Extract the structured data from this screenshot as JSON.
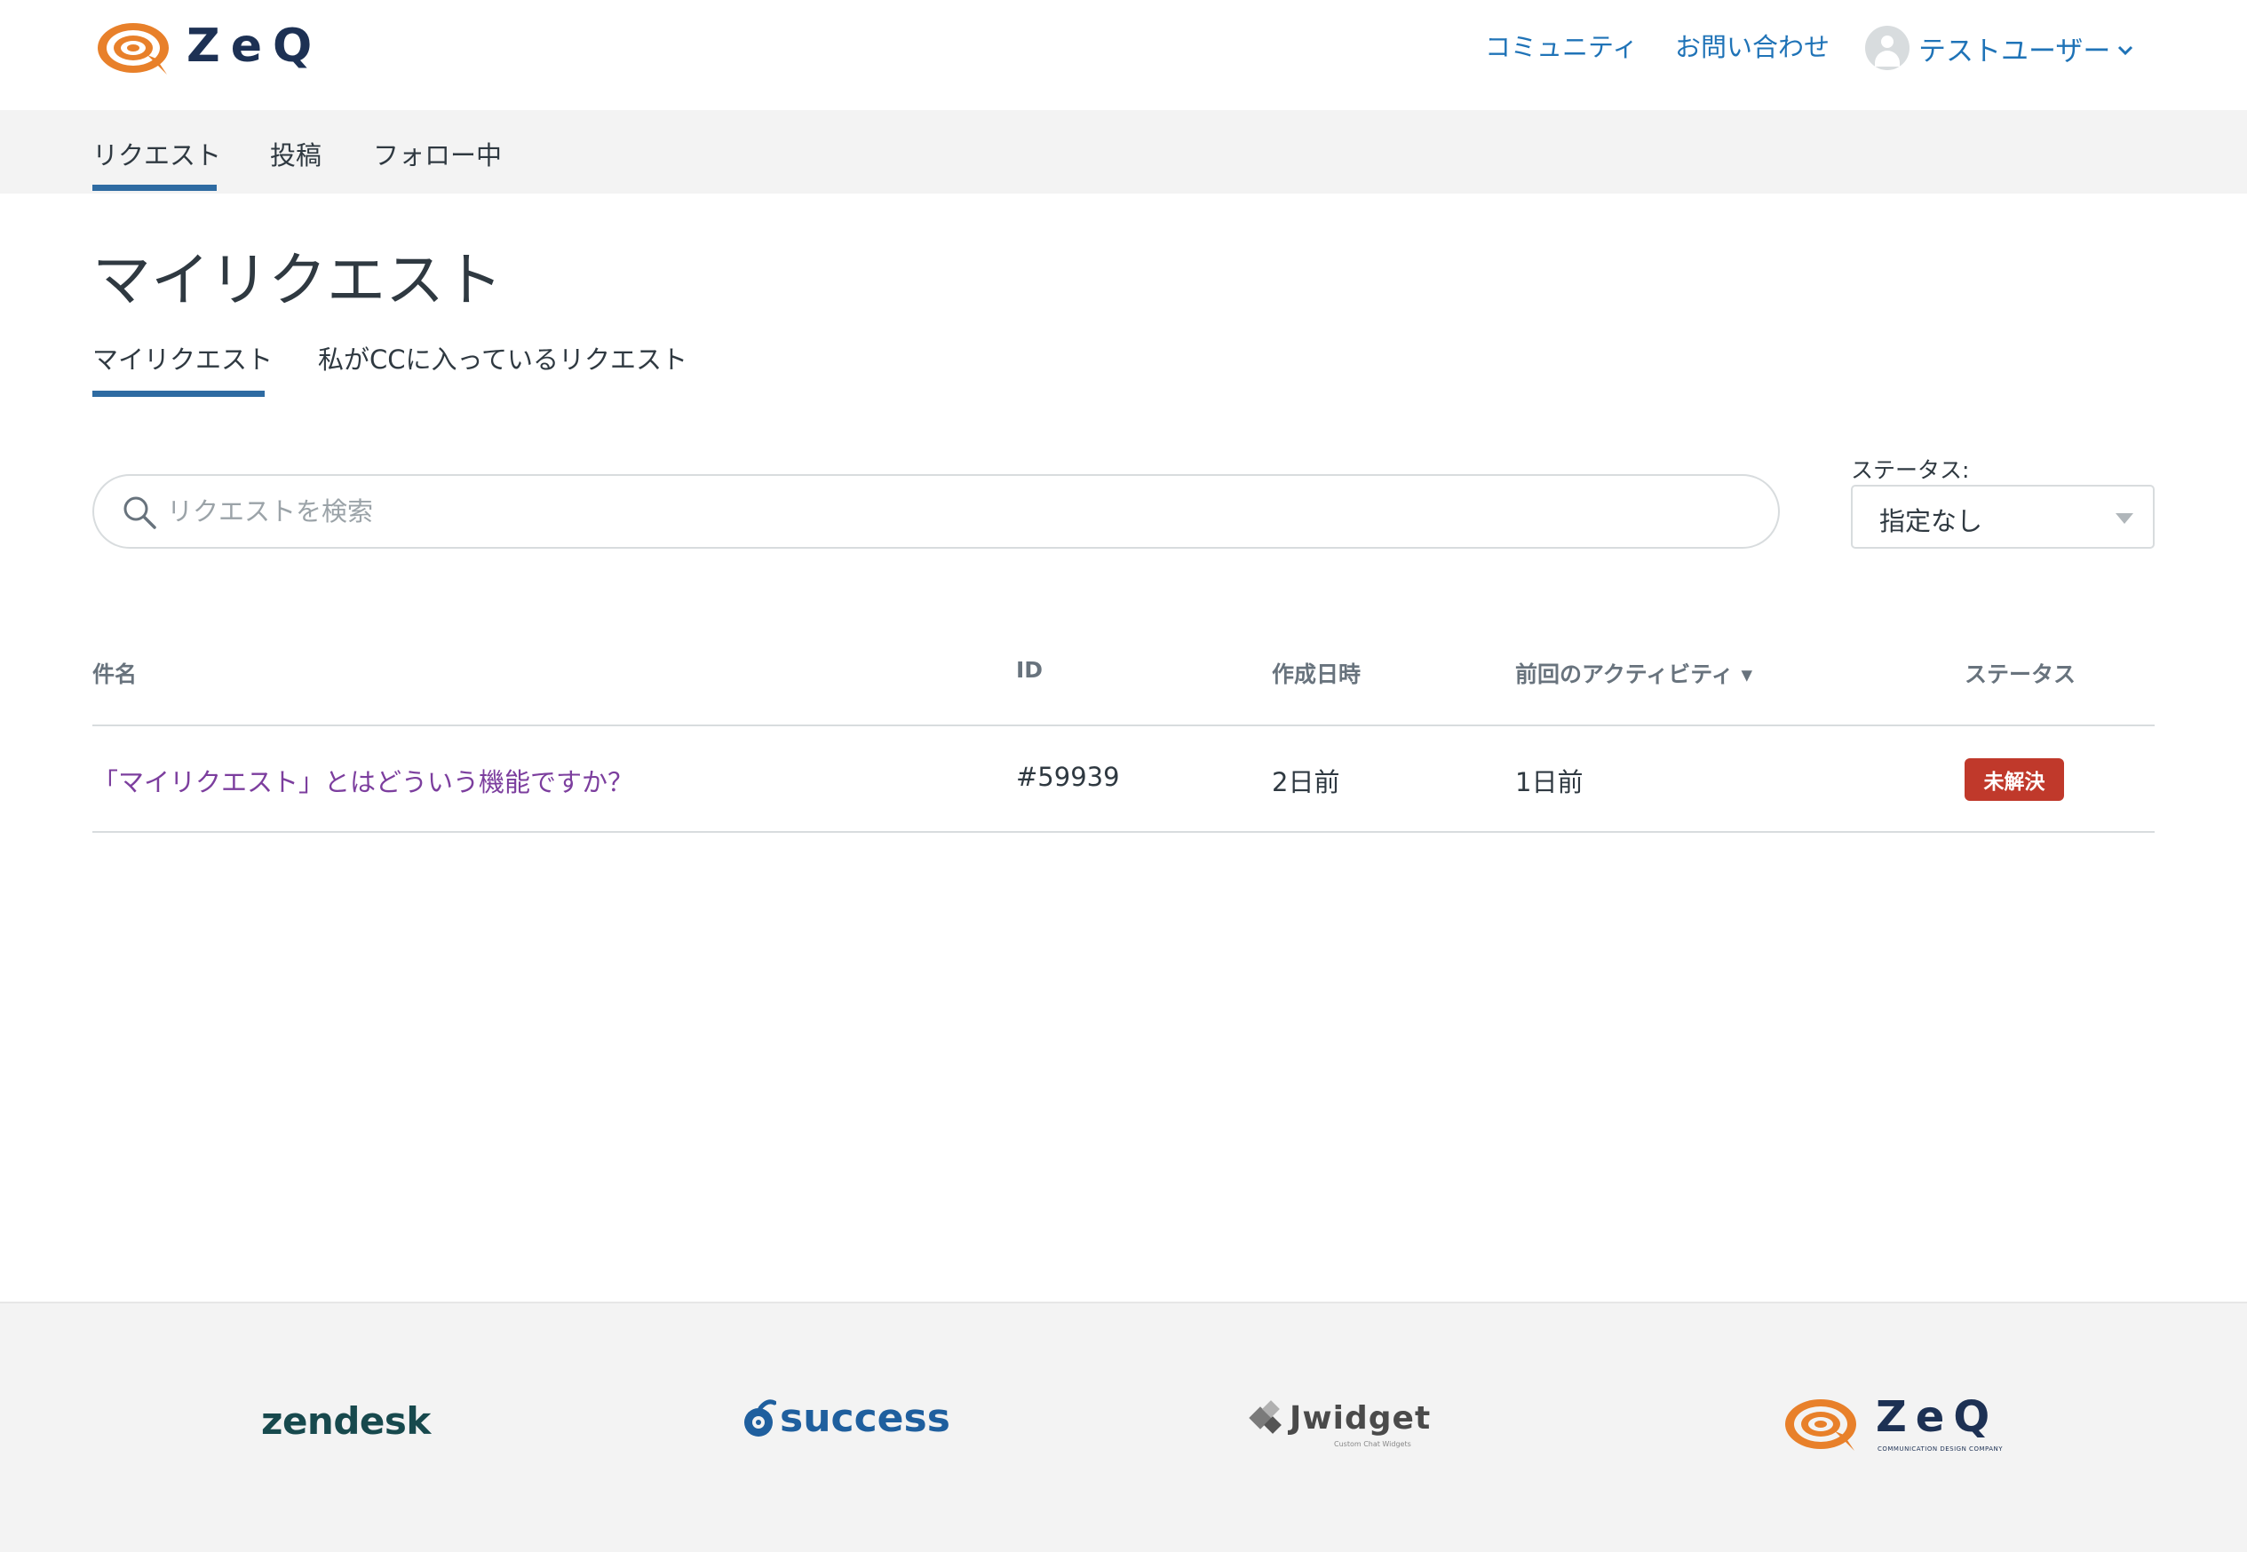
{
  "header": {
    "logo_text": "ZeQ",
    "nav": {
      "community": "コミュニティ",
      "contact": "お問い合わせ"
    },
    "user_name": "テストユーザー"
  },
  "subnav": {
    "items": [
      "リクエスト",
      "投稿",
      "フォロー中"
    ],
    "active_index": 0
  },
  "page": {
    "title": "マイリクエスト",
    "tabs": [
      "マイリクエスト",
      "私がCCに入っているリクエスト"
    ],
    "active_tab": 0
  },
  "search": {
    "placeholder": "リクエストを検索",
    "value": ""
  },
  "filter": {
    "label": "ステータス:",
    "selected": "指定なし"
  },
  "table": {
    "columns": [
      "件名",
      "ID",
      "作成日時",
      "前回のアクティビティ ▾",
      "ステータス"
    ],
    "rows": [
      {
        "subject": "「マイリクエスト」とはどういう機能ですか？",
        "id": "#59939",
        "created": "2日前",
        "last_activity": "1日前",
        "status": "未解決"
      }
    ]
  },
  "footer": {
    "logos": [
      "zendesk",
      "success",
      "Jwidget",
      "ZeQ"
    ],
    "jwidget_tagline": "Custom Chat Widgets",
    "zeq_tagline": "COMMUNICATION DESIGN COMPANY"
  },
  "colors": {
    "link": "#1f73b7",
    "accent": "#2e6ba2",
    "visited_link": "#7c3e9e",
    "badge_open": "#c0392b",
    "brand_orange": "#e8802a",
    "brand_navy": "#1d3154"
  }
}
